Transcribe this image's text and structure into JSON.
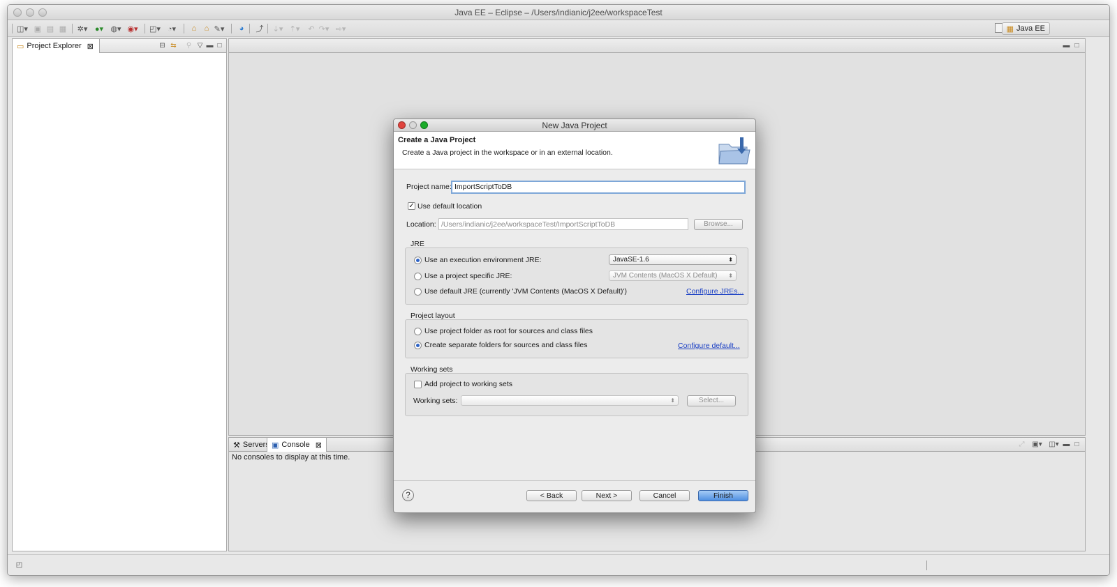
{
  "window": {
    "title": "Java EE – Eclipse – /Users/indianic/j2ee/workspaceTest"
  },
  "toolbar": {
    "perspective_label": "Java EE"
  },
  "project_explorer": {
    "tab_label": "Project Explorer"
  },
  "bottom_panel": {
    "tabs": [
      {
        "label": "Servers"
      },
      {
        "label": "Console"
      }
    ],
    "message": "No consoles to display at this time."
  },
  "dialog": {
    "title": "New Java Project",
    "header_title": "Create a Java Project",
    "header_description": "Create a Java project in the workspace or in an external location.",
    "project_name_label": "Project name:",
    "project_name_value": "ImportScriptToDB",
    "use_default_location_label": "Use default location",
    "use_default_location_checked": true,
    "location_label": "Location:",
    "location_value": "/Users/indianic/j2ee/workspaceTest/ImportScriptToDB",
    "browse_label": "Browse...",
    "jre": {
      "group_label": "JRE",
      "option_exec_env": "Use an execution environment JRE:",
      "exec_env_value": "JavaSE-1.6",
      "option_project_specific": "Use a project specific JRE:",
      "project_specific_value": "JVM Contents (MacOS X Default)",
      "option_default": "Use default JRE (currently 'JVM Contents (MacOS X Default)')",
      "configure_link": "Configure JREs...",
      "selected": "exec_env"
    },
    "project_layout": {
      "group_label": "Project layout",
      "option_root": "Use project folder as root for sources and class files",
      "option_separate": "Create separate folders for sources and class files",
      "configure_link": "Configure default...",
      "selected": "separate"
    },
    "working_sets": {
      "group_label": "Working sets",
      "add_label": "Add project to working sets",
      "add_checked": false,
      "sets_label": "Working sets:",
      "sets_value": "",
      "select_label": "Select..."
    },
    "footer": {
      "help": "?",
      "back": "< Back",
      "next": "Next >",
      "cancel": "Cancel",
      "finish": "Finish"
    }
  },
  "colors": {
    "focus_border": "#7ea7d8",
    "link": "#1a3fc4",
    "primary_button": "#4f8fe1",
    "close_dot": "#e0443e",
    "minimize_dot": "#dea123",
    "zoom_dot": "#1aab29"
  }
}
